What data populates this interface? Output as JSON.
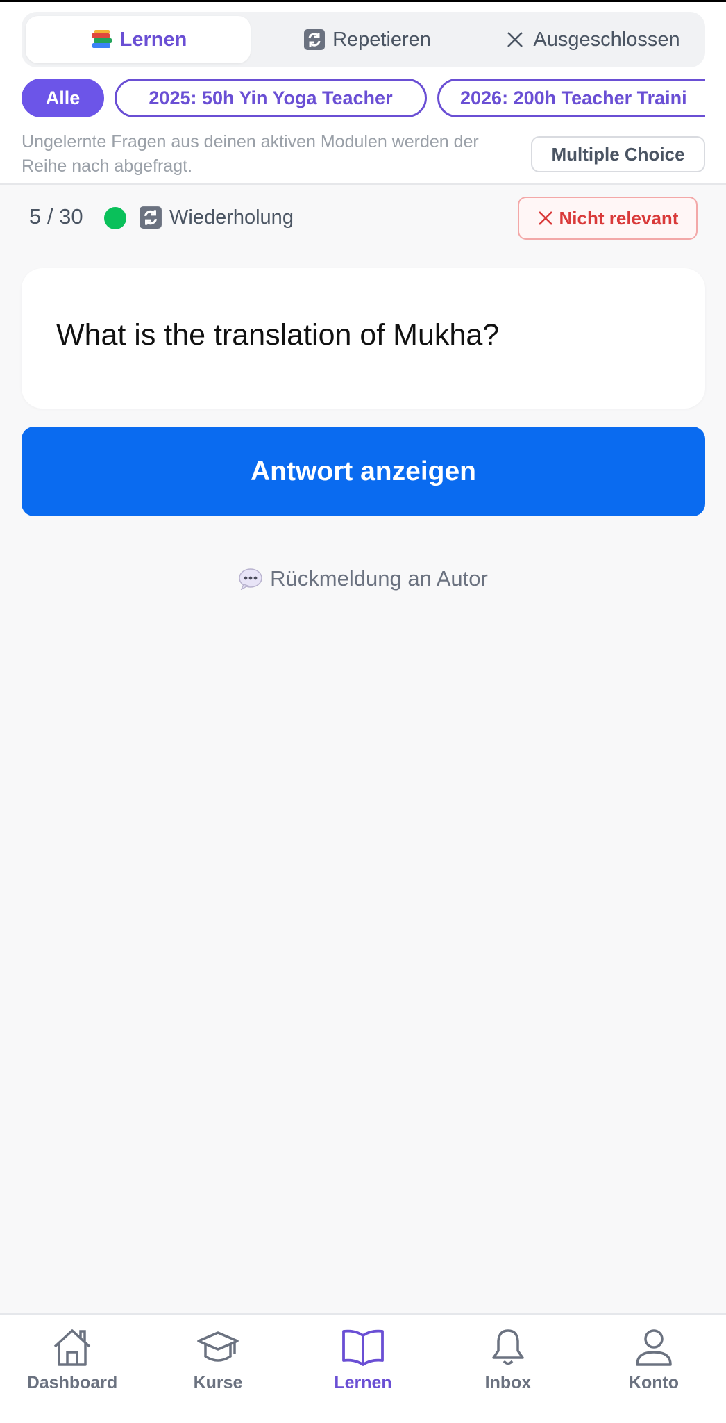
{
  "tabs": [
    {
      "label": "Lernen",
      "icon": "books-icon",
      "active": true
    },
    {
      "label": "Repetieren",
      "icon": "repeat-icon",
      "active": false
    },
    {
      "label": "Ausgeschlossen",
      "icon": "close-icon",
      "active": false
    }
  ],
  "chips": [
    {
      "label": "Alle",
      "selected": true
    },
    {
      "label": "2025: 50h Yin Yoga Teacher",
      "selected": false
    },
    {
      "label": "2026: 200h Teacher Traini",
      "selected": false
    }
  ],
  "hint": "Ungelernte Fragen aus deinen aktiven Modulen werden der Reihe nach abgefragt.",
  "mode_button": "Multiple Choice",
  "status": {
    "counter": "5 / 30",
    "dot_color": "#0ac05a",
    "repeat_label": "Wiederholung",
    "not_relevant_label": "Nicht relevant"
  },
  "question": "What is the translation of Mukha?",
  "show_answer_label": "Antwort anzeigen",
  "feedback_label": "Rückmeldung an Autor",
  "nav": [
    {
      "label": "Dashboard",
      "icon": "home-icon",
      "active": false
    },
    {
      "label": "Kurse",
      "icon": "graduation-cap-icon",
      "active": false
    },
    {
      "label": "Lernen",
      "icon": "book-open-icon",
      "active": true
    },
    {
      "label": "Inbox",
      "icon": "bell-icon",
      "active": false
    },
    {
      "label": "Konto",
      "icon": "user-icon",
      "active": false
    }
  ],
  "colors": {
    "accent": "#6a4fd4",
    "primary_button": "#0a6bf0",
    "danger": "#d93a3a"
  }
}
